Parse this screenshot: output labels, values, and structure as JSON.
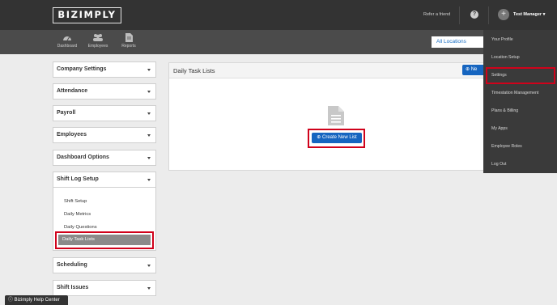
{
  "header": {
    "logo": "BIZIMPLY",
    "refer_link": "Refer a friend",
    "help_icon": "?",
    "user_name": "Test Manager ▾"
  },
  "subnav": {
    "items": [
      {
        "label": "Dashboard",
        "icon": "speedometer-icon"
      },
      {
        "label": "Employees",
        "icon": "people-icon"
      },
      {
        "label": "Reports",
        "icon": "document-icon"
      }
    ],
    "location_selector": "All Locations"
  },
  "sidebar": {
    "sections": [
      {
        "label": "Company Settings"
      },
      {
        "label": "Attendance"
      },
      {
        "label": "Payroll"
      },
      {
        "label": "Employees"
      },
      {
        "label": "Dashboard Options"
      },
      {
        "label": "Shift Log Setup"
      },
      {
        "label": "Scheduling"
      },
      {
        "label": "Shift Issues"
      }
    ],
    "shift_log_items": [
      "Shift Setup",
      "Daily Metrics",
      "Daily Questions",
      "Daily Task Lists"
    ]
  },
  "main": {
    "title": "Daily Task Lists",
    "new_button": "Ne",
    "create_button": "Create New List"
  },
  "dropdown": {
    "items": [
      "Your Profile",
      "Location Setup",
      "Settings",
      "Timestation Management",
      "Plans & Billing",
      "My Apps",
      "Employee Roles",
      "Log Out"
    ]
  },
  "help_center": "Bizimply Help Center",
  "colors": {
    "brand_blue": "#1665c0",
    "highlight_red": "#d0021b",
    "header_dark": "#333333"
  }
}
